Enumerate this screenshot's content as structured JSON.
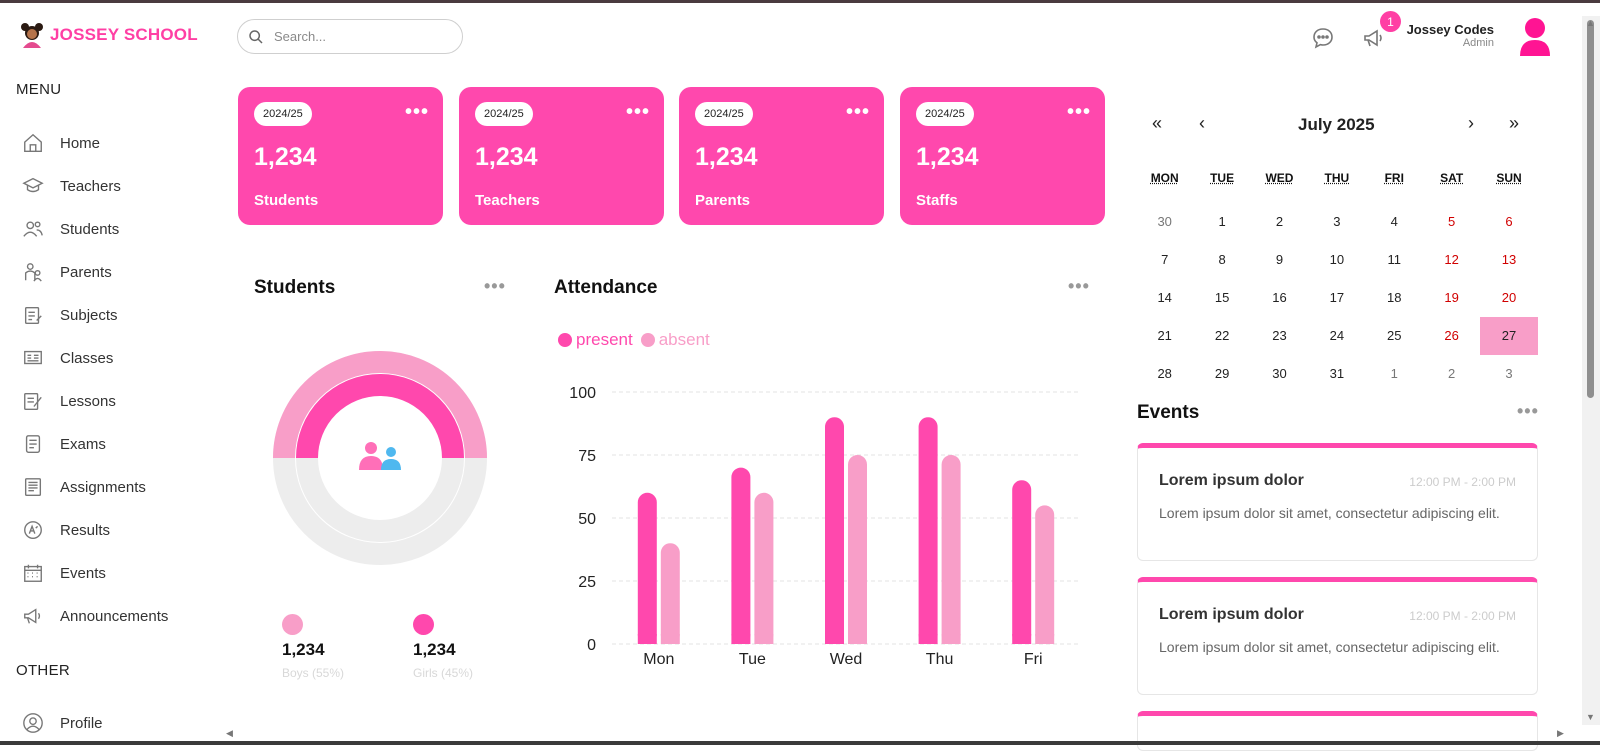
{
  "brand": {
    "name": "JOSSEY SCHOOL",
    "accent": "#ff48ad"
  },
  "sidebar": {
    "menu_heading": "MENU",
    "other_heading": "OTHER",
    "items": [
      {
        "label": "Home",
        "icon": "home-icon"
      },
      {
        "label": "Teachers",
        "icon": "graduation-cap-icon"
      },
      {
        "label": "Students",
        "icon": "users-icon"
      },
      {
        "label": "Parents",
        "icon": "parents-icon"
      },
      {
        "label": "Subjects",
        "icon": "subjects-icon"
      },
      {
        "label": "Classes",
        "icon": "classes-icon"
      },
      {
        "label": "Lessons",
        "icon": "lessons-icon"
      },
      {
        "label": "Exams",
        "icon": "exams-icon"
      },
      {
        "label": "Assignments",
        "icon": "assignments-icon"
      },
      {
        "label": "Results",
        "icon": "results-icon"
      },
      {
        "label": "Events",
        "icon": "calendar-icon"
      },
      {
        "label": "Announcements",
        "icon": "megaphone-icon"
      }
    ],
    "other_items": [
      {
        "label": "Profile",
        "icon": "profile-icon"
      }
    ]
  },
  "topbar": {
    "search_placeholder": "Search...",
    "notification_count": "1",
    "user_name": "Jossey Codes",
    "user_role": "Admin"
  },
  "cards": [
    {
      "year": "2024/25",
      "value": "1,234",
      "label": "Students"
    },
    {
      "year": "2024/25",
      "value": "1,234",
      "label": "Teachers"
    },
    {
      "year": "2024/25",
      "value": "1,234",
      "label": "Parents"
    },
    {
      "year": "2024/25",
      "value": "1,234",
      "label": "Staffs"
    }
  ],
  "students_panel": {
    "title": "Students",
    "boys": {
      "value": "1,234",
      "label": "Boys (55%)",
      "color": "#f89ec8"
    },
    "girls": {
      "value": "1,234",
      "label": "Girls (45%)",
      "color": "#ff48ad"
    }
  },
  "attendance_panel": {
    "title": "Attendance",
    "legend": [
      {
        "label": "present",
        "color": "#ff48ad"
      },
      {
        "label": "absent",
        "color": "#f89ec8"
      }
    ]
  },
  "chart_data": [
    {
      "type": "bar",
      "title": "Attendance",
      "categories": [
        "Mon",
        "Tue",
        "Wed",
        "Thu",
        "Fri"
      ],
      "series": [
        {
          "name": "present",
          "values": [
            60,
            70,
            90,
            90,
            65
          ],
          "color": "#ff48ad"
        },
        {
          "name": "absent",
          "values": [
            40,
            60,
            75,
            75,
            55
          ],
          "color": "#f89ec8"
        }
      ],
      "ylim": [
        0,
        100
      ],
      "yticks": [
        0,
        25,
        50,
        75,
        100
      ],
      "grid": true,
      "legend": "top-left"
    },
    {
      "type": "pie",
      "title": "Students",
      "series": [
        {
          "name": "Boys",
          "values": [
            55
          ],
          "color": "#f89ec8"
        },
        {
          "name": "Girls",
          "values": [
            45
          ],
          "color": "#ff48ad"
        }
      ]
    }
  ],
  "calendar": {
    "month": "July 2025",
    "nav": {
      "prev_year": "«",
      "prev": "‹",
      "next": "›",
      "next_year": "»"
    },
    "weekdays": [
      "MON",
      "TUE",
      "WED",
      "THU",
      "FRI",
      "SAT",
      "SUN"
    ],
    "days": [
      {
        "d": "30",
        "t": "muted"
      },
      {
        "d": "1"
      },
      {
        "d": "2"
      },
      {
        "d": "3"
      },
      {
        "d": "4"
      },
      {
        "d": "5",
        "t": "wkend"
      },
      {
        "d": "6",
        "t": "wkend"
      },
      {
        "d": "7"
      },
      {
        "d": "8"
      },
      {
        "d": "9"
      },
      {
        "d": "10"
      },
      {
        "d": "11"
      },
      {
        "d": "12",
        "t": "wkend"
      },
      {
        "d": "13",
        "t": "wkend"
      },
      {
        "d": "14"
      },
      {
        "d": "15"
      },
      {
        "d": "16"
      },
      {
        "d": "17"
      },
      {
        "d": "18"
      },
      {
        "d": "19",
        "t": "wkend"
      },
      {
        "d": "20",
        "t": "wkend"
      },
      {
        "d": "21"
      },
      {
        "d": "22"
      },
      {
        "d": "23"
      },
      {
        "d": "24"
      },
      {
        "d": "25"
      },
      {
        "d": "26",
        "t": "wkend"
      },
      {
        "d": "27",
        "t": "sel"
      },
      {
        "d": "28"
      },
      {
        "d": "29"
      },
      {
        "d": "30"
      },
      {
        "d": "31"
      },
      {
        "d": "1",
        "t": "muted"
      },
      {
        "d": "2",
        "t": "muted"
      },
      {
        "d": "3",
        "t": "muted"
      }
    ]
  },
  "events": {
    "title": "Events",
    "items": [
      {
        "title": "Lorem ipsum dolor",
        "time": "12:00 PM - 2:00 PM",
        "description": "Lorem ipsum dolor sit amet, consectetur adipiscing elit."
      },
      {
        "title": "Lorem ipsum dolor",
        "time": "12:00 PM - 2:00 PM",
        "description": "Lorem ipsum dolor sit amet, consectetur adipiscing elit."
      }
    ]
  }
}
